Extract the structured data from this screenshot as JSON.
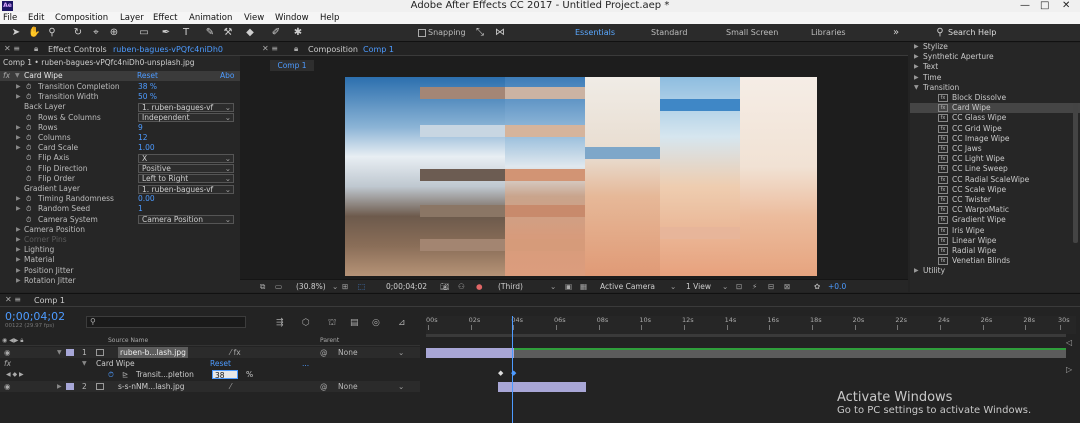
{
  "window": {
    "app_icon": "Ae",
    "title": "Adobe After Effects CC 2017 - Untitled Project.aep *",
    "controls": [
      "—",
      "□",
      "✕"
    ]
  },
  "menu": [
    "File",
    "Edit",
    "Composition",
    "Layer",
    "Effect",
    "Animation",
    "View",
    "Window",
    "Help"
  ],
  "toolbar": {
    "snapping": "Snapping",
    "workspaces": [
      "Essentials",
      "Standard",
      "Small Screen",
      "Libraries"
    ],
    "active_workspace": "Essentials",
    "search_placeholder": "Search Help",
    "icons": [
      "selection-tool-icon",
      "hand-tool-icon",
      "zoom-tool-icon",
      "rotate-tool-icon",
      "camera-tool-icon",
      "pan-behind-tool-icon",
      "rectangle-tool-icon",
      "pen-tool-icon",
      "type-tool-icon",
      "brush-tool-icon",
      "clone-stamp-icon",
      "eraser-icon",
      "roto-brush-icon",
      "puppet-pin-icon"
    ]
  },
  "effect_controls": {
    "tab_label": "Effect Controls",
    "tab_file": "ruben-bagues-vPQfc4niDh0",
    "subtitle": "Comp 1 • ruben-bagues-vPQfc4niDh0-unsplash.jpg",
    "effect_name": "Card Wipe",
    "reset": "Reset",
    "about": "Abo",
    "properties": [
      {
        "label": "Transition Completion",
        "value": "38 %",
        "stopwatch": true,
        "twirl": true
      },
      {
        "label": "Transition Width",
        "value": "50 %",
        "stopwatch": true,
        "twirl": true
      },
      {
        "label": "Back Layer",
        "dropdown": "1. ruben-bagues-vf"
      },
      {
        "label": "Rows & Columns",
        "dropdown": "Independent",
        "stopwatch": true
      },
      {
        "label": "Rows",
        "value": "9",
        "stopwatch": true,
        "twirl": true
      },
      {
        "label": "Columns",
        "value": "12",
        "stopwatch": true,
        "twirl": true
      },
      {
        "label": "Card Scale",
        "value": "1.00",
        "stopwatch": true,
        "twirl": true
      },
      {
        "label": "Flip Axis",
        "dropdown": "X",
        "stopwatch": true
      },
      {
        "label": "Flip Direction",
        "dropdown": "Positive",
        "stopwatch": true
      },
      {
        "label": "Flip Order",
        "dropdown": "Left to Right",
        "stopwatch": true
      },
      {
        "label": "Gradient Layer",
        "dropdown": "1. ruben-bagues-vf"
      },
      {
        "label": "Timing Randomness",
        "value": "0.00",
        "stopwatch": true,
        "twirl": true
      },
      {
        "label": "Random Seed",
        "value": "1",
        "stopwatch": true,
        "twirl": true
      },
      {
        "label": "Camera System",
        "dropdown": "Camera Position",
        "stopwatch": true
      },
      {
        "label": "Camera Position",
        "twirl": true
      },
      {
        "label": "Corner Pins",
        "twirl": true,
        "disabled": true
      },
      {
        "label": "Lighting",
        "twirl": true
      },
      {
        "label": "Material",
        "twirl": true
      },
      {
        "label": "Position Jitter",
        "twirl": true
      },
      {
        "label": "Rotation Jitter",
        "twirl": true
      }
    ]
  },
  "composition": {
    "tab_label": "Composition",
    "tab_name": "Comp 1",
    "breadcrumb": "Comp 1",
    "zoom": "(30.8%)",
    "timecode": "0;00;04;02",
    "view": "(Third)",
    "camera": "Active Camera",
    "views": "1 View",
    "exposure": "+0.0"
  },
  "effects_presets": {
    "categories_top": [
      "Stylize",
      "Synthetic Aperture",
      "Text",
      "Time",
      "Transition"
    ],
    "transition_items": [
      "Block Dissolve",
      "Card Wipe",
      "CC Glass Wipe",
      "CC Grid Wipe",
      "CC Image Wipe",
      "CC Jaws",
      "CC Light Wipe",
      "CC Line Sweep",
      "CC Radial ScaleWipe",
      "CC Scale Wipe",
      "CC Twister",
      "CC WarpoMatic",
      "Gradient Wipe",
      "Iris Wipe",
      "Linear Wipe",
      "Radial Wipe",
      "Venetian Blinds"
    ],
    "selected": "Card Wipe",
    "categories_bottom": [
      "Utility"
    ]
  },
  "timeline": {
    "tab_label": "Comp 1",
    "timecode": "0;00;04;02",
    "frame_info": "00122 (29.97 fps)",
    "search_placeholder": "",
    "col_source": "Source Name",
    "col_parent": "Parent",
    "ruler": [
      "00s",
      "02s",
      "04s",
      "06s",
      "08s",
      "10s",
      "12s",
      "14s",
      "16s",
      "18s",
      "20s",
      "22s",
      "24s",
      "26s",
      "28s",
      "30s"
    ],
    "layers": [
      {
        "num": "1",
        "name": "ruben-b...lash.jpg",
        "parent": "None"
      },
      {
        "num": "2",
        "name": "s-s-nNM...lash.jpg",
        "parent": "None"
      }
    ],
    "effects_label": "Effects",
    "card_wipe": "Card Wipe",
    "reset": "Reset",
    "prop_name": "Transit...pletion",
    "prop_value": "38",
    "prop_unit": "%",
    "playhead_fraction": 0.135
  },
  "watermark": {
    "line1": "Activate Windows",
    "line2": "Go to PC settings to activate Windows."
  }
}
